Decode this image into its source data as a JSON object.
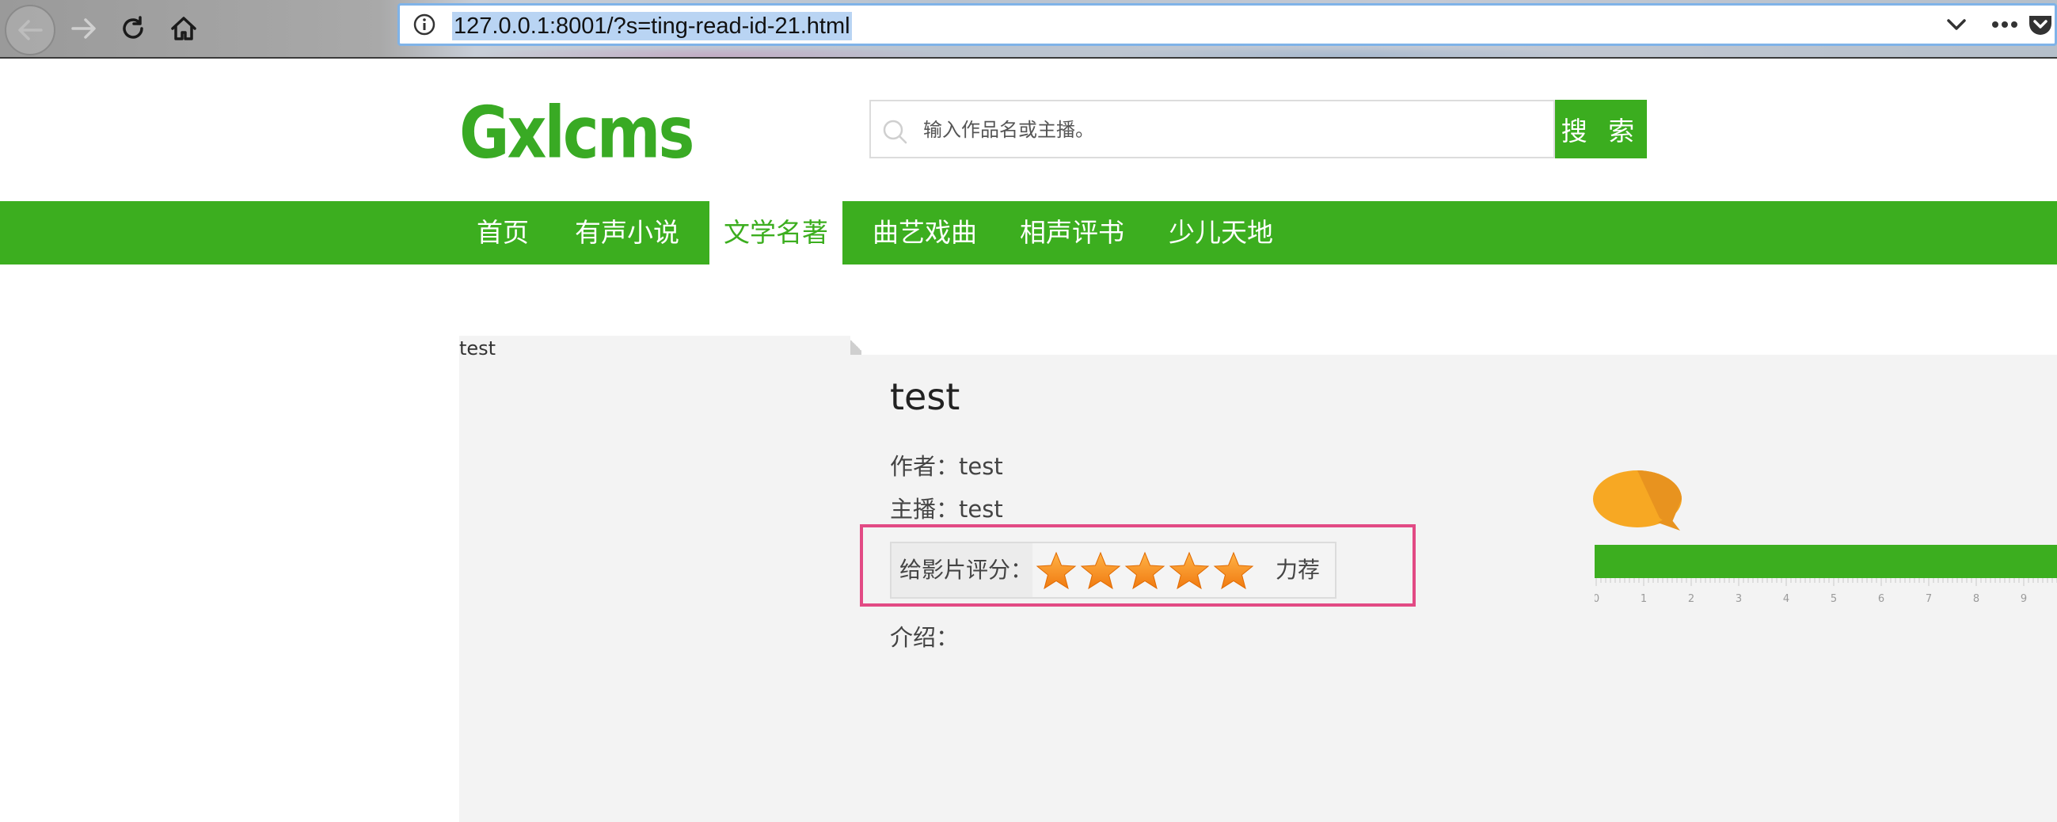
{
  "browser": {
    "url": "127.0.0.1:8001/?s=ting-read-id-21.html",
    "icons": [
      "back-arrow-icon",
      "forward-arrow-icon",
      "reload-icon",
      "home-icon",
      "info-icon",
      "chevron-down-icon",
      "more-dots-icon",
      "pocket-icon"
    ]
  },
  "site": {
    "logo": "Gxlcms",
    "search": {
      "placeholder": "输入作品名或主播。",
      "button": "搜 索"
    },
    "nav": [
      {
        "label": "首页",
        "active": false
      },
      {
        "label": "有声小说",
        "active": false
      },
      {
        "label": "文学名著",
        "active": true
      },
      {
        "label": "曲艺戏曲",
        "active": false
      },
      {
        "label": "相声评书",
        "active": false
      },
      {
        "label": "少儿天地",
        "active": false
      }
    ],
    "brand_color": "#3cae1f"
  },
  "book": {
    "cover_alt": "test",
    "title": "test",
    "author_line": "作者：test",
    "narrator_line": "主播：test",
    "rating": {
      "label": "给影片评分：",
      "stars": 5,
      "max": 5,
      "text": "力荐"
    },
    "intro_line": "介绍："
  },
  "player": {
    "ruler_ticks": [
      "0",
      "1",
      "2",
      "3",
      "4",
      "5",
      "6",
      "7",
      "8",
      "9"
    ],
    "highlight_color": "#e24a84"
  }
}
